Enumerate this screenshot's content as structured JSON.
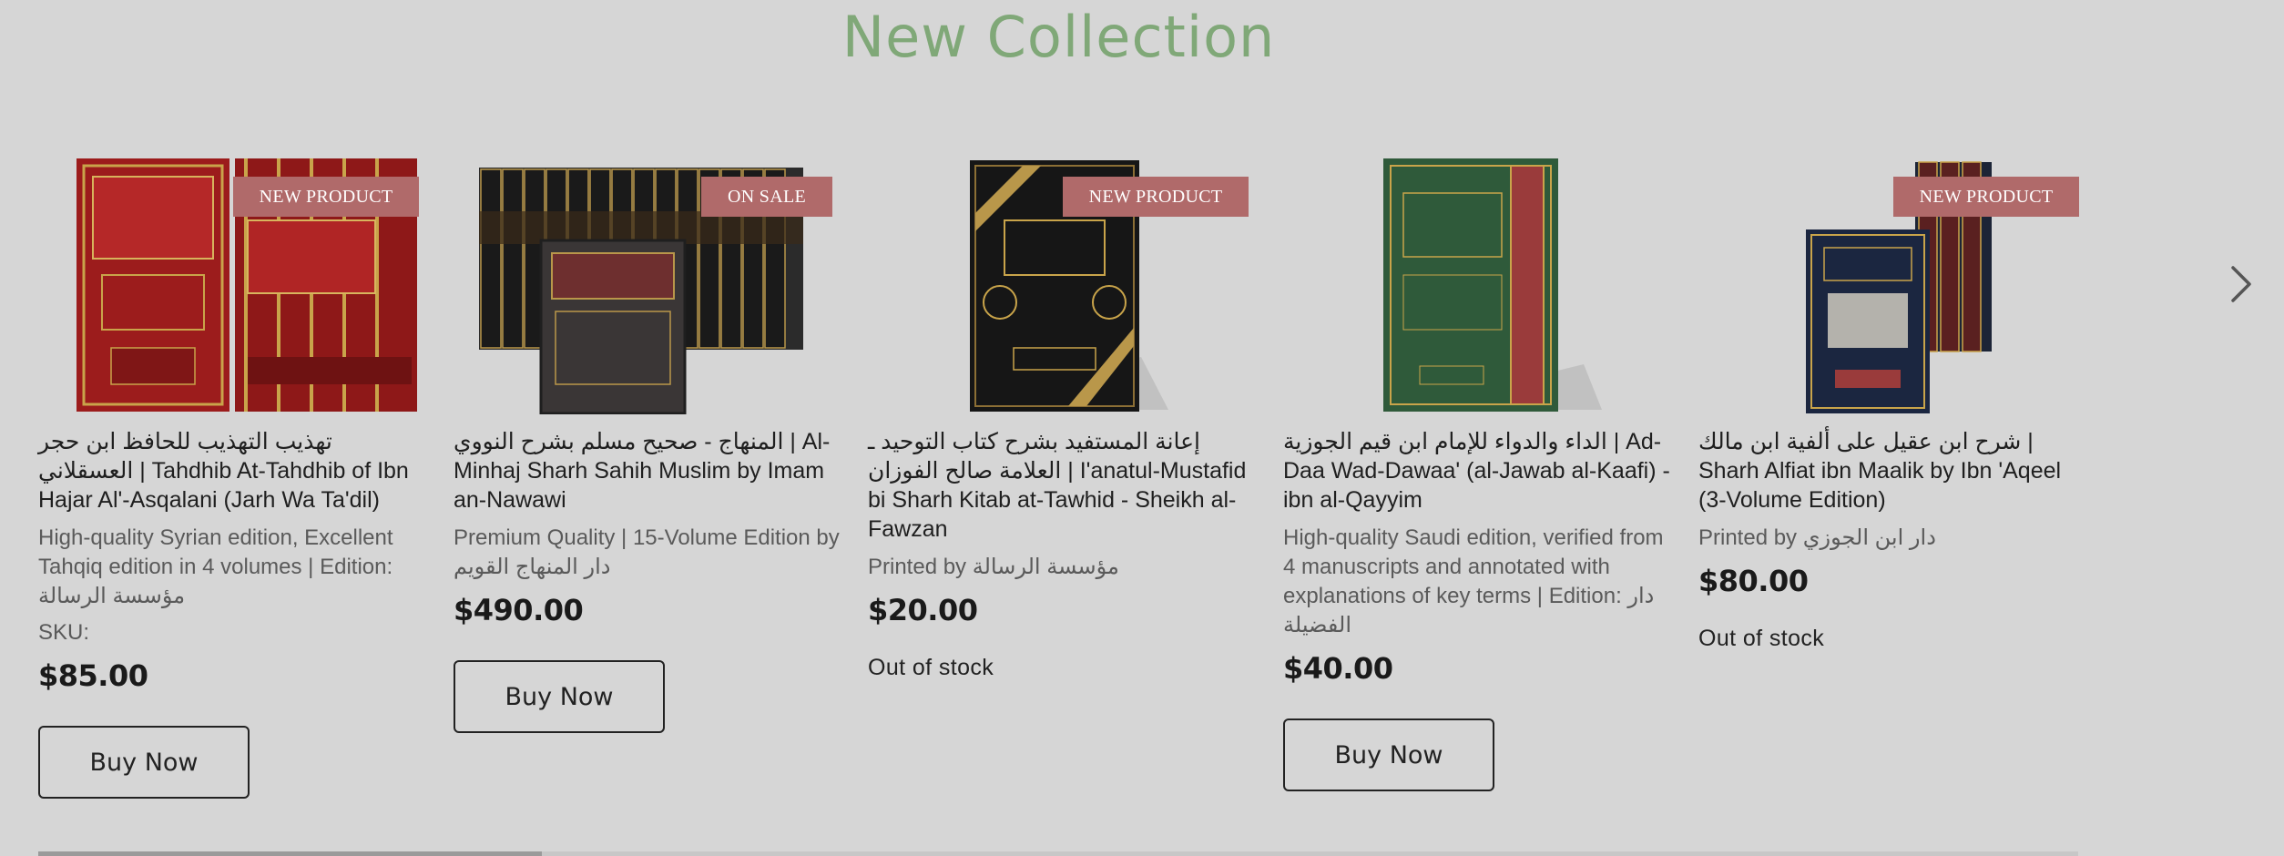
{
  "section": {
    "title": "New Collection",
    "title_color": "#80a878",
    "ribbon_color": "#b06a6a",
    "next_icon": "chevron-right-icon"
  },
  "products": [
    {
      "ribbon": "NEW PRODUCT",
      "name": "تهذيب التهذيب للحافظ ابن حجر العسقلاني | Tahdhib At-Tahdhib of Ibn Hajar Al'-Asqalani (Jarh Wa Ta'dil)",
      "description": "High-quality Syrian edition, Excellent Tahqiq edition in 4 volumes | Edition: مؤسسة الرسالة",
      "sku": "SKU:",
      "price": "$85.00",
      "stock": "",
      "button": "Buy Now"
    },
    {
      "ribbon": "ON SALE",
      "name": "المنهاج - صحيح مسلم بشرح النووي | Al-Minhaj Sharh Sahih Muslim by Imam an-Nawawi",
      "description": "Premium Quality | 15-Volume Edition by دار المنهاج القويم",
      "sku": "",
      "price": "$490.00",
      "stock": "",
      "button": "Buy Now"
    },
    {
      "ribbon": "NEW PRODUCT",
      "name": "إعانة المستفيد بشرح كتاب التوحيد ـ العلامة صالح الفوزان | I'anatul-Mustafid bi Sharh Kitab at-Tawhid - Sheikh al-Fawzan",
      "description": "Printed by مؤسسة الرسالة",
      "sku": "",
      "price": "$20.00",
      "stock": "Out of stock",
      "button": ""
    },
    {
      "ribbon": "",
      "name": "الداء والدواء للإمام ابن قيم الجوزية | Ad-Daa Wad-Dawaa' (al-Jawab al-Kaafi) - ibn al-Qayyim",
      "description": "High-quality Saudi edition, verified from 4 manuscripts and annotated with explanations of key terms | Edition: دار الفضيلة",
      "sku": "",
      "price": "$40.00",
      "stock": "",
      "button": "Buy Now"
    },
    {
      "ribbon": "NEW PRODUCT",
      "name": "شرح ابن عقيل على ألفية ابن مالك | Sharh Alfiat ibn Maalik by Ibn 'Aqeel (3-Volume Edition)",
      "description": "Printed by دار ابن الجوزي",
      "sku": "",
      "price": "$80.00",
      "stock": "Out of stock",
      "button": ""
    }
  ]
}
